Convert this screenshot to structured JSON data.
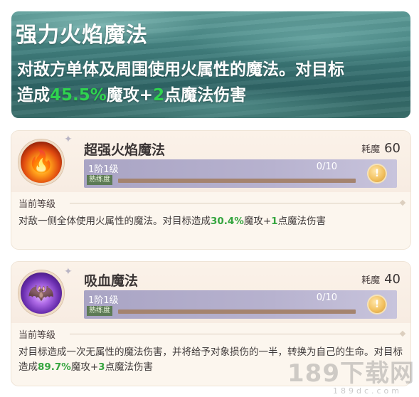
{
  "banner": {
    "title": "强力火焰魔法",
    "desc_line1": "对敌方单体及周围使用火属性的魔法。对目标",
    "desc_pre": "造成",
    "desc_pct": "45.5%",
    "desc_mid": "魔攻+",
    "desc_num": "2",
    "desc_post": "点魔法伤害"
  },
  "skills": [
    {
      "icon": "fire-icon",
      "name": "超强火焰魔法",
      "cost_label": "耗魔",
      "cost_value": "60",
      "level": "1阶1级",
      "exp": "0/10",
      "proficiency_label": "熟练度",
      "proficiency": 0,
      "section": "当前等级",
      "effect_pre": "对敌一侧全体使用火属性的魔法。对目标造成",
      "effect_pct": "30.4%",
      "effect_mid": "魔攻+",
      "effect_num": "1",
      "effect_post": "点魔法伤害"
    },
    {
      "icon": "vampire-icon",
      "name": "吸血魔法",
      "cost_label": "耗魔",
      "cost_value": "40",
      "level": "1阶1级",
      "exp": "0/10",
      "proficiency_label": "熟练度",
      "proficiency": 0,
      "section": "当前等级",
      "effect_pre": "对目标造成一次无属性的魔法伤害，并将给予对象损伤的一半，转换为自己的生命。对目标造成",
      "effect_pct": "89.7%",
      "effect_mid": "魔攻+",
      "effect_num": "3",
      "effect_post": "点魔法伤害"
    }
  ],
  "watermark": "189下载网",
  "watermark_sub": "189dc.com",
  "colors": {
    "highlight_banner": "#2fd34f",
    "highlight_card": "#35a53f",
    "level_bar": "#b7b2cf",
    "proficiency_track": "#a4836e"
  }
}
